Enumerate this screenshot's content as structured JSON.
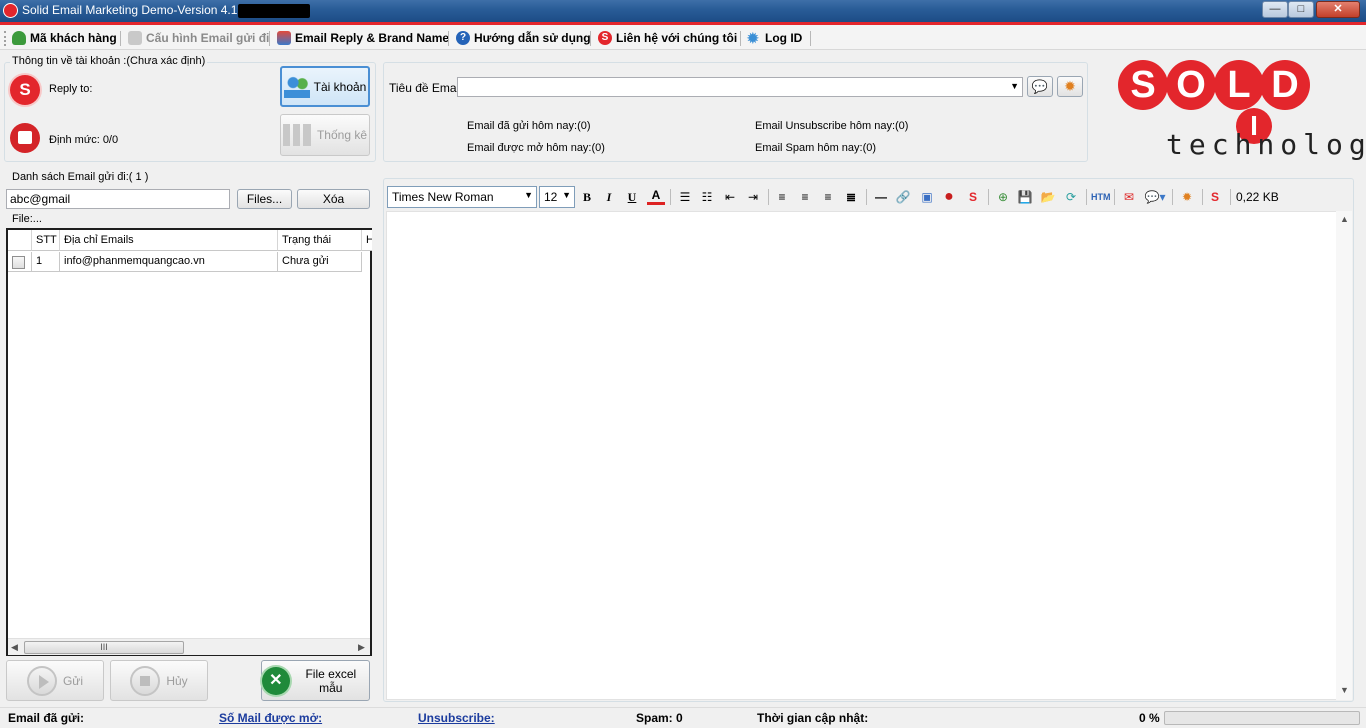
{
  "window": {
    "title": "Solid Email Marketing Demo-Version 4.1"
  },
  "menu": {
    "items": [
      {
        "label": "Mã khách hàng",
        "icon": "user-icon",
        "enabled": true
      },
      {
        "label": "Cấu hình Email gửi đi",
        "icon": "mail-config-icon",
        "enabled": false
      },
      {
        "label": "Email Reply & Brand Name",
        "icon": "brand-name-icon",
        "enabled": true
      },
      {
        "label": "Hướng dẫn sử dụng",
        "icon": "help-icon",
        "enabled": true
      },
      {
        "label": "Liên hệ với chúng tôi",
        "icon": "contact-icon",
        "enabled": true
      },
      {
        "label": "Log ID",
        "icon": "gear-icon",
        "enabled": true
      }
    ]
  },
  "account": {
    "group_label": "Thông tin về tài khoản :(Chưa xác định)",
    "reply_to_label": "Reply to:",
    "quota_label": "Định mức: 0/0",
    "account_button": "Tài khoản",
    "stats_button": "Thống kê"
  },
  "email_header": {
    "subject_label": "Tiêu đề Email:",
    "subject_value": "",
    "stats": {
      "sent_today": "Email đã gửi hôm nay:(0)",
      "opened_today": "Email được mở hôm nay:(0)",
      "unsubscribe_today": "Email Unsubscribe hôm nay:(0)",
      "spam_today": "Email Spam hôm nay:(0)"
    }
  },
  "logo": {
    "letters": [
      "S",
      "O",
      "L",
      "D"
    ],
    "i_letter": "I",
    "tagline": "technology"
  },
  "email_list": {
    "group_label": "Danh sách Email gửi đi:( 1 )",
    "input_value": "abc@gmail",
    "files_button": "Files...",
    "delete_button": "Xóa",
    "file_label": "File:...",
    "columns": [
      "STT",
      "Địa chỉ Emails",
      "Trạng thái",
      "H"
    ],
    "rows": [
      {
        "stt": "1",
        "email": "info@phanmemquangcao.vn",
        "status": "Chưa gửi",
        "checked": false
      }
    ],
    "scroll_thumb": "III"
  },
  "actions": {
    "send_button": "Gửi",
    "cancel_button": "Hủy",
    "excel_button": "File excel mẫu"
  },
  "editor": {
    "font": "Times New Roman",
    "size": "12",
    "file_size": "0,22 KB",
    "body": ""
  },
  "status": {
    "sent_label": "Email đã gửi:",
    "opened_link": "Số Mail được mở:",
    "unsubscribe_link": "Unsubscribe:",
    "spam_label": "Spam: 0",
    "updated_label": "Thời gian cập nhật:",
    "progress_text": "0 %",
    "progress_value": 0
  },
  "colors": {
    "brand_red": "#e3262c",
    "titlebar": "#2a5d98",
    "link_blue": "#1c3c9e"
  }
}
